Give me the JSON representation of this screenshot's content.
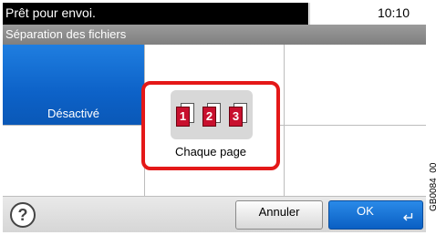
{
  "status": {
    "message": "Prêt pour envoi.",
    "time": "10:10"
  },
  "title": "Séparation des fichiers",
  "options": {
    "off_label": "Désactivé",
    "each_page_label": "Chaque page",
    "each_page_icons": [
      "1",
      "2",
      "3"
    ]
  },
  "footer": {
    "help_symbol": "?",
    "cancel_label": "Annuler",
    "ok_label": "OK",
    "enter_symbol": "↵"
  },
  "caption": "GB0084_00",
  "colors": {
    "selected_blue": "#0d62c8",
    "highlight_red": "#e41818",
    "page_red": "#c8102e"
  },
  "icons": [
    "help-icon",
    "page-1-icon",
    "page-2-icon",
    "page-3-icon",
    "enter-icon"
  ]
}
